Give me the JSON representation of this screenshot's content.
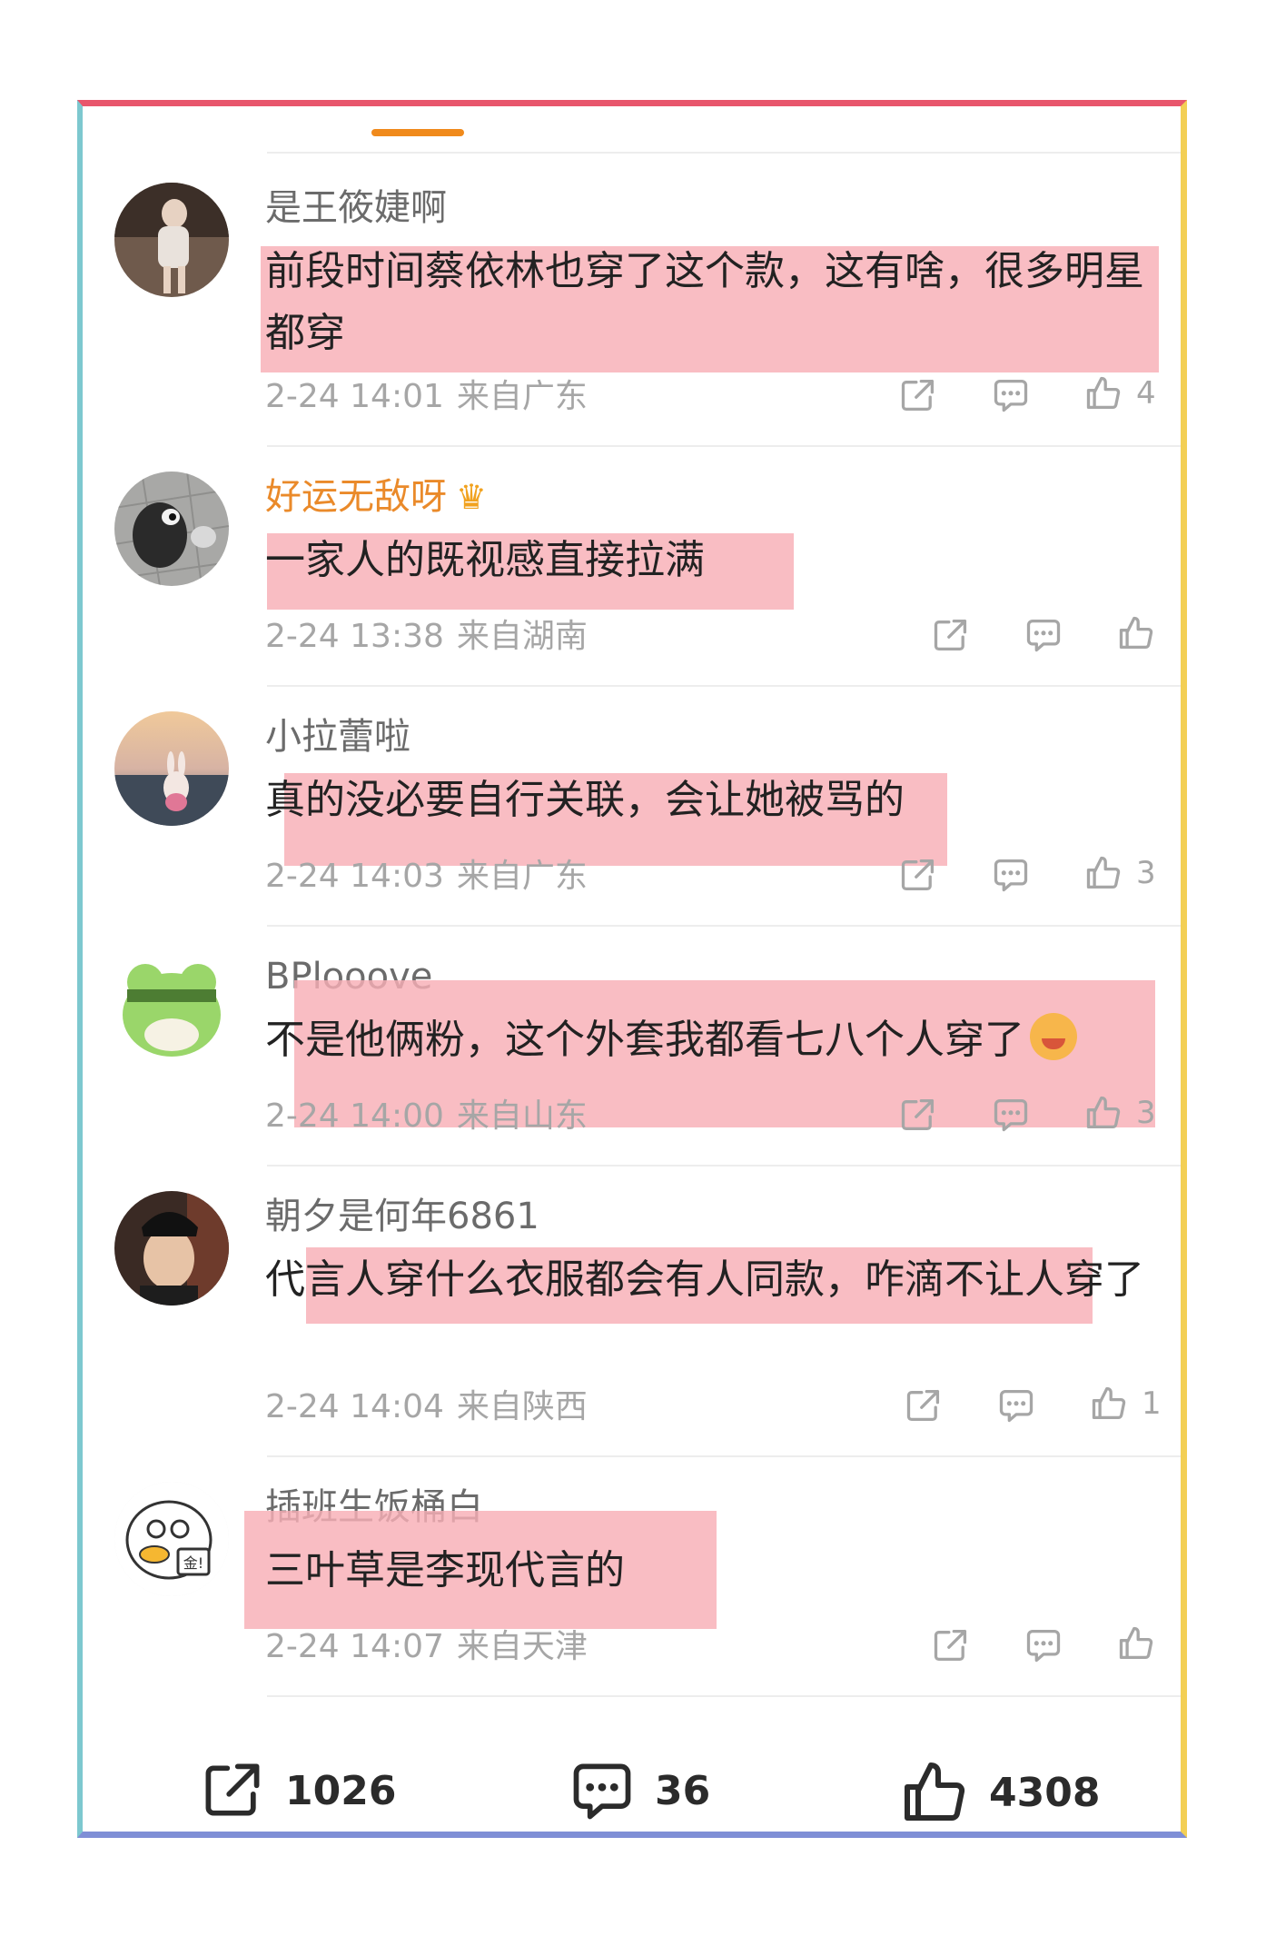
{
  "comments": [
    {
      "user": "是王筱婕啊",
      "text": "前段时间蔡依林也穿了这个款，这有啥，很多明星都穿",
      "time": "2-24 14:01",
      "location": "来自广东",
      "likes": "4"
    },
    {
      "user": "好运无敌呀",
      "text": "一家人的既视感直接拉满",
      "time": "2-24 13:38",
      "location": "来自湖南",
      "likes": ""
    },
    {
      "user": "小拉蕾啦",
      "text": "真的没必要自行关联，会让她被骂的",
      "time": "2-24 14:03",
      "location": "来自广东",
      "likes": "3"
    },
    {
      "user": "BPlooove",
      "text": "不是他俩粉，这个外套我都看七八个人穿了",
      "time": "2-24 14:00",
      "location": "来自山东",
      "likes": "3"
    },
    {
      "user": "朝夕是何年6861",
      "text": "代言人穿什么衣服都会有人同款，咋滴不让人穿了",
      "time": "2-24 14:04",
      "location": "来自陕西",
      "likes": "1"
    },
    {
      "user": "插班生饭桶白",
      "text": "三叶草是李现代言的",
      "time": "2-24 14:07",
      "location": "来自天津",
      "likes": ""
    }
  ],
  "footer": {
    "reposts": "1026",
    "comments": "36",
    "likes": "4308"
  },
  "colors": {
    "highlight": "#f8afb6",
    "vip_name": "#ea8a2a",
    "tab_indicator": "#f08a1c",
    "meta": "#a6a6a6"
  }
}
